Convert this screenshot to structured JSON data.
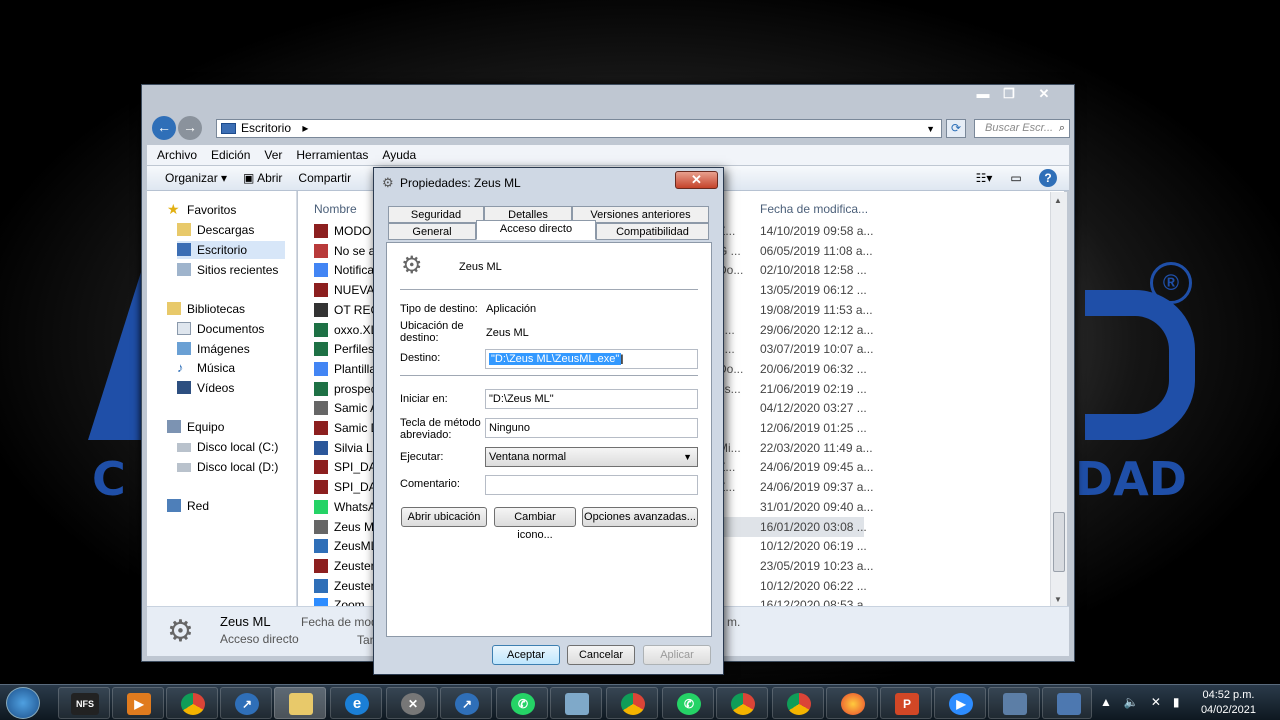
{
  "explorer": {
    "address": "Escritorio",
    "search_placeholder": "Buscar Escr...",
    "menu": [
      "Archivo",
      "Edición",
      "Ver",
      "Herramientas",
      "Ayuda"
    ],
    "cmd": {
      "organize": "Organizar",
      "open": "Abrir",
      "share": "Compartir"
    },
    "nav": {
      "favorites": "Favoritos",
      "downloads": "Descargas",
      "desktop": "Escritorio",
      "recent": "Sitios recientes",
      "libraries": "Bibliotecas",
      "documents": "Documentos",
      "images": "Imágenes",
      "music": "Música",
      "videos": "Vídeos",
      "computer": "Equipo",
      "disk_c": "Disco local (C:)",
      "disk_d": "Disco local (D:)",
      "network": "Red"
    },
    "columns": {
      "name": "Nombre",
      "modified": "Fecha de modifica..."
    },
    "files": [
      {
        "name": "MODO I",
        "type": "Z...",
        "date": "14/10/2019 09:58 a..."
      },
      {
        "name": "No se ac",
        "type": "G ...",
        "date": "06/05/2019 11:08 a..."
      },
      {
        "name": "Notificac",
        "type": "Do...",
        "date": "02/10/2018 12:58 ..."
      },
      {
        "name": "NUEVA",
        "type": "",
        "date": "13/05/2019 06:12 ..."
      },
      {
        "name": "OT RECI",
        "type": "",
        "date": "19/08/2019 11:53 a..."
      },
      {
        "name": "oxxo.XL",
        "type": "d...",
        "date": "29/06/2020 12:12 a..."
      },
      {
        "name": "Perfiles.",
        "type": "d...",
        "date": "03/07/2019 10:07 a..."
      },
      {
        "name": "Plantilla",
        "type": "Do...",
        "date": "20/06/2019 06:32 ..."
      },
      {
        "name": "prospect",
        "type": "es...",
        "date": "21/06/2019 02:19 ..."
      },
      {
        "name": "Samic A",
        "type": "",
        "date": "04/12/2020 03:27 ..."
      },
      {
        "name": "Samic D",
        "type": "",
        "date": "12/06/2019 01:25 ..."
      },
      {
        "name": "Silvia La",
        "type": "Mi...",
        "date": "22/03/2020 11:49 a..."
      },
      {
        "name": "SPI_DAT",
        "type": "Z...",
        "date": "24/06/2019 09:45 a..."
      },
      {
        "name": "SPI_DAT",
        "type": "Z...",
        "date": "24/06/2019 09:37 a..."
      },
      {
        "name": "WhatsAp",
        "type": "",
        "date": "31/01/2020 09:40 a..."
      },
      {
        "name": "Zeus ML",
        "type": "",
        "date": "16/01/2020 03:08 ..."
      },
      {
        "name": "ZeusML",
        "type": "",
        "date": "10/12/2020 06:19 ..."
      },
      {
        "name": "Zeuster",
        "type": "",
        "date": "23/05/2019 10:23 a..."
      },
      {
        "name": "Zeuster",
        "type": "",
        "date": "10/12/2020 06:22 ..."
      },
      {
        "name": "Zoom",
        "type": "",
        "date": "16/12/2020 08:53 a..."
      }
    ],
    "details": {
      "name": "Zeus ML",
      "kind": "Acceso directo",
      "modified_label": "Fecha de modi",
      "tam": "Tan",
      "extra": "m."
    }
  },
  "dialog": {
    "title": "Propiedades: Zeus ML",
    "tabs_top": [
      "Seguridad",
      "Detalles",
      "Versiones anteriores"
    ],
    "tabs_bottom": [
      "General",
      "Acceso directo",
      "Compatibilidad"
    ],
    "name": "Zeus ML",
    "target_type_label": "Tipo de destino:",
    "target_type": "Aplicación",
    "target_loc_label_1": "Ubicación de",
    "target_loc_label_2": "destino:",
    "target_loc": "Zeus ML",
    "target_label": "Destino:",
    "target": "\"D:\\Zeus ML\\ZeusML.exe\"",
    "start_label": "Iniciar en:",
    "start": "\"D:\\Zeus ML\"",
    "hotkey_label_1": "Tecla de método",
    "hotkey_label_2": "abreviado:",
    "hotkey": "Ninguno",
    "run_label": "Ejecutar:",
    "run": "Ventana normal",
    "comment_label": "Comentario:",
    "comment": "",
    "btn_open_loc": "Abrir ubicación",
    "btn_change_icon": "Cambiar icono...",
    "btn_advanced": "Opciones avanzadas...",
    "btn_ok": "Aceptar",
    "btn_cancel": "Cancelar",
    "btn_apply": "Aplicar"
  },
  "background": {
    "logo_letters_left": "C",
    "logo_letters_right": "DAD",
    "logo_registered": "®"
  },
  "taskbar": {
    "time": "04:52 p.m.",
    "date": "04/02/2021"
  }
}
